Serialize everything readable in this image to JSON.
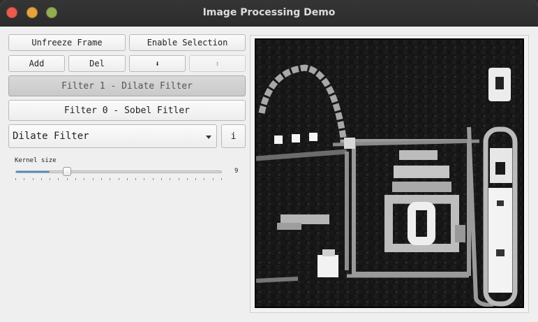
{
  "window": {
    "title": "Image Processing Demo"
  },
  "toolbar": {
    "unfreeze_label": "Unfreeze Frame",
    "enable_selection_label": "Enable Selection",
    "add_label": "Add",
    "del_label": "Del",
    "move_down_glyph": "⬇",
    "move_up_glyph": "⬆"
  },
  "filters": {
    "items": [
      {
        "label": "Filter 1 - Dilate Filter",
        "selected": true
      },
      {
        "label": "Filter 0 - Sobel Fitler",
        "selected": false
      }
    ]
  },
  "filter_select": {
    "value": "Dilate Filter",
    "info_label": "i"
  },
  "kernel": {
    "label": "Kernel size",
    "value": 9,
    "value_text": "9",
    "min": 1,
    "max": 50
  },
  "colors": {
    "accent": "#3b8fd6",
    "titlebar": "#2f2f2f",
    "close": "#e95b4e",
    "minimize": "#e6a23c",
    "maximize": "#93ad52"
  }
}
